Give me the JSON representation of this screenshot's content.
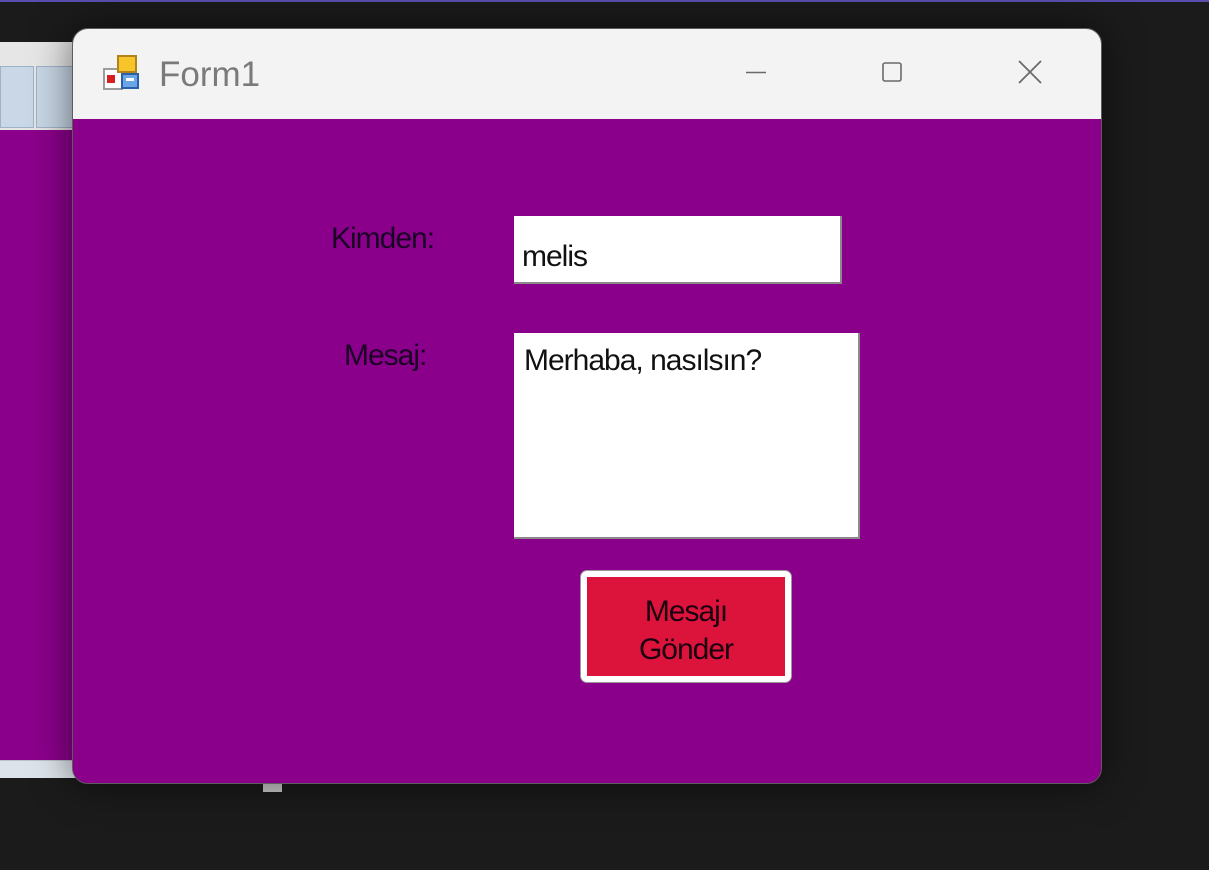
{
  "window": {
    "title": "Form1",
    "background_color": "#8b008b",
    "icon": "windows-form-app-icon",
    "controls": {
      "minimize_icon": "minimize-icon",
      "maximize_icon": "maximize-icon",
      "close_icon": "close-icon"
    }
  },
  "form": {
    "from_label": "Kimden:",
    "from_value": "melis",
    "message_label": "Mesaj:",
    "message_value": "Merhaba, nasılsın?",
    "send_button_label": "Mesajı Gönder",
    "send_button_color": "#dc143c"
  }
}
